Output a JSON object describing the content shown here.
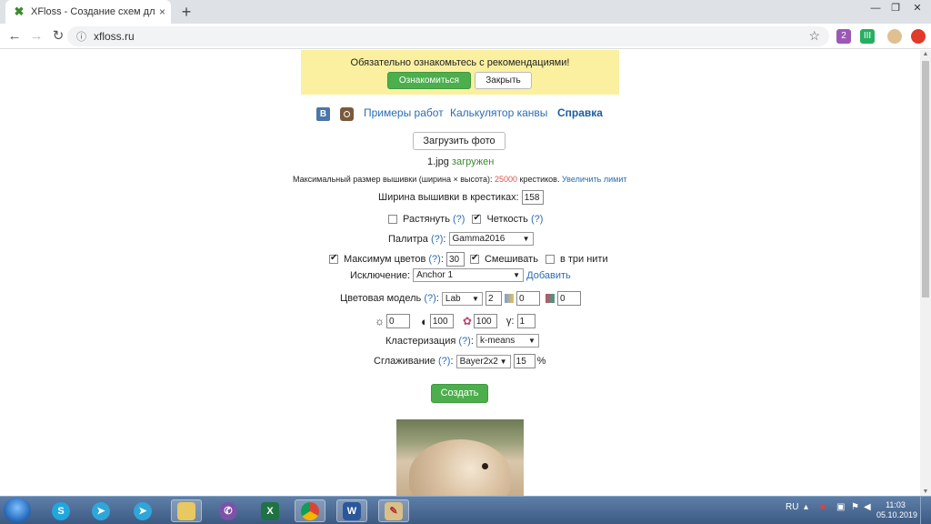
{
  "browser": {
    "tab_title": "XFloss - Создание схем для выш",
    "tab_close": "×",
    "new_tab": "+",
    "url": "xfloss.ru",
    "window_controls": {
      "minimize": "—",
      "maximize": "❐",
      "close": "✕"
    },
    "extensions": [
      {
        "name": "extension-1-icon",
        "badge": "2",
        "color": "#9b59b6"
      },
      {
        "name": "extension-2-icon",
        "badge": "III",
        "color": "#27ae60"
      },
      {
        "name": "profile-avatar-icon",
        "badge": "",
        "color": "#e0c090"
      },
      {
        "name": "extension-red-icon",
        "badge": "",
        "color": "#e03a2a"
      }
    ]
  },
  "banner": {
    "message": "Обязательно ознакомьтесь с рекомендациями!",
    "primary_button": "Ознакомиться",
    "close_button": "Закрыть"
  },
  "nav": {
    "vk": "B",
    "examples": "Примеры работ",
    "calculator": "Калькулятор канвы",
    "help": "Справка"
  },
  "upload": {
    "button": "Загрузить фото",
    "filename": "1.jpg",
    "status": "загружен"
  },
  "limits": {
    "text_before": "Максимальный размер вышивки (ширина × высота):",
    "value": "25000",
    "text_after": "крестиков.",
    "link": "Увеличить лимит"
  },
  "form": {
    "width_label": "Ширина вышивки в крестиках:",
    "width_value": "158",
    "stretch_label": "Растянуть",
    "sharpness_label": "Четкость",
    "q": "(?)",
    "palette_label": "Палитра",
    "palette_value": "Gamma2016",
    "max_colors_label": "Максимум цветов",
    "max_colors_value": "30",
    "mix_label": "Смешивать",
    "three_threads_label": "в три нити",
    "exclusion_label": "Исключение:",
    "exclusion_value": "Anchor 1",
    "add_link": "Добавить",
    "color_model_label": "Цветовая модель",
    "color_model_value": "Lab",
    "color_model_v1": "2",
    "color_model_v2": "0",
    "color_model_v3": "0",
    "brightness": "0",
    "contrast": "100",
    "saturation": "100",
    "gamma_label": "γ:",
    "gamma_value": "1",
    "clustering_label": "Кластеризация",
    "clustering_value": "k-means",
    "smoothing_label": "Сглаживание",
    "smoothing_value": "Bayer2x2",
    "smoothing_pct": "15",
    "pct_sign": "%",
    "create_button": "Создать",
    "colon": ":"
  },
  "taskbar": {
    "lang": "RU",
    "time": "11:03",
    "date": "05.10.2019",
    "apps": [
      "skype-icon",
      "telegram-icon",
      "telegram-icon-2",
      "file-explorer-icon",
      "viber-icon",
      "excel-icon",
      "chrome-icon",
      "word-icon",
      "paint-icon"
    ]
  }
}
